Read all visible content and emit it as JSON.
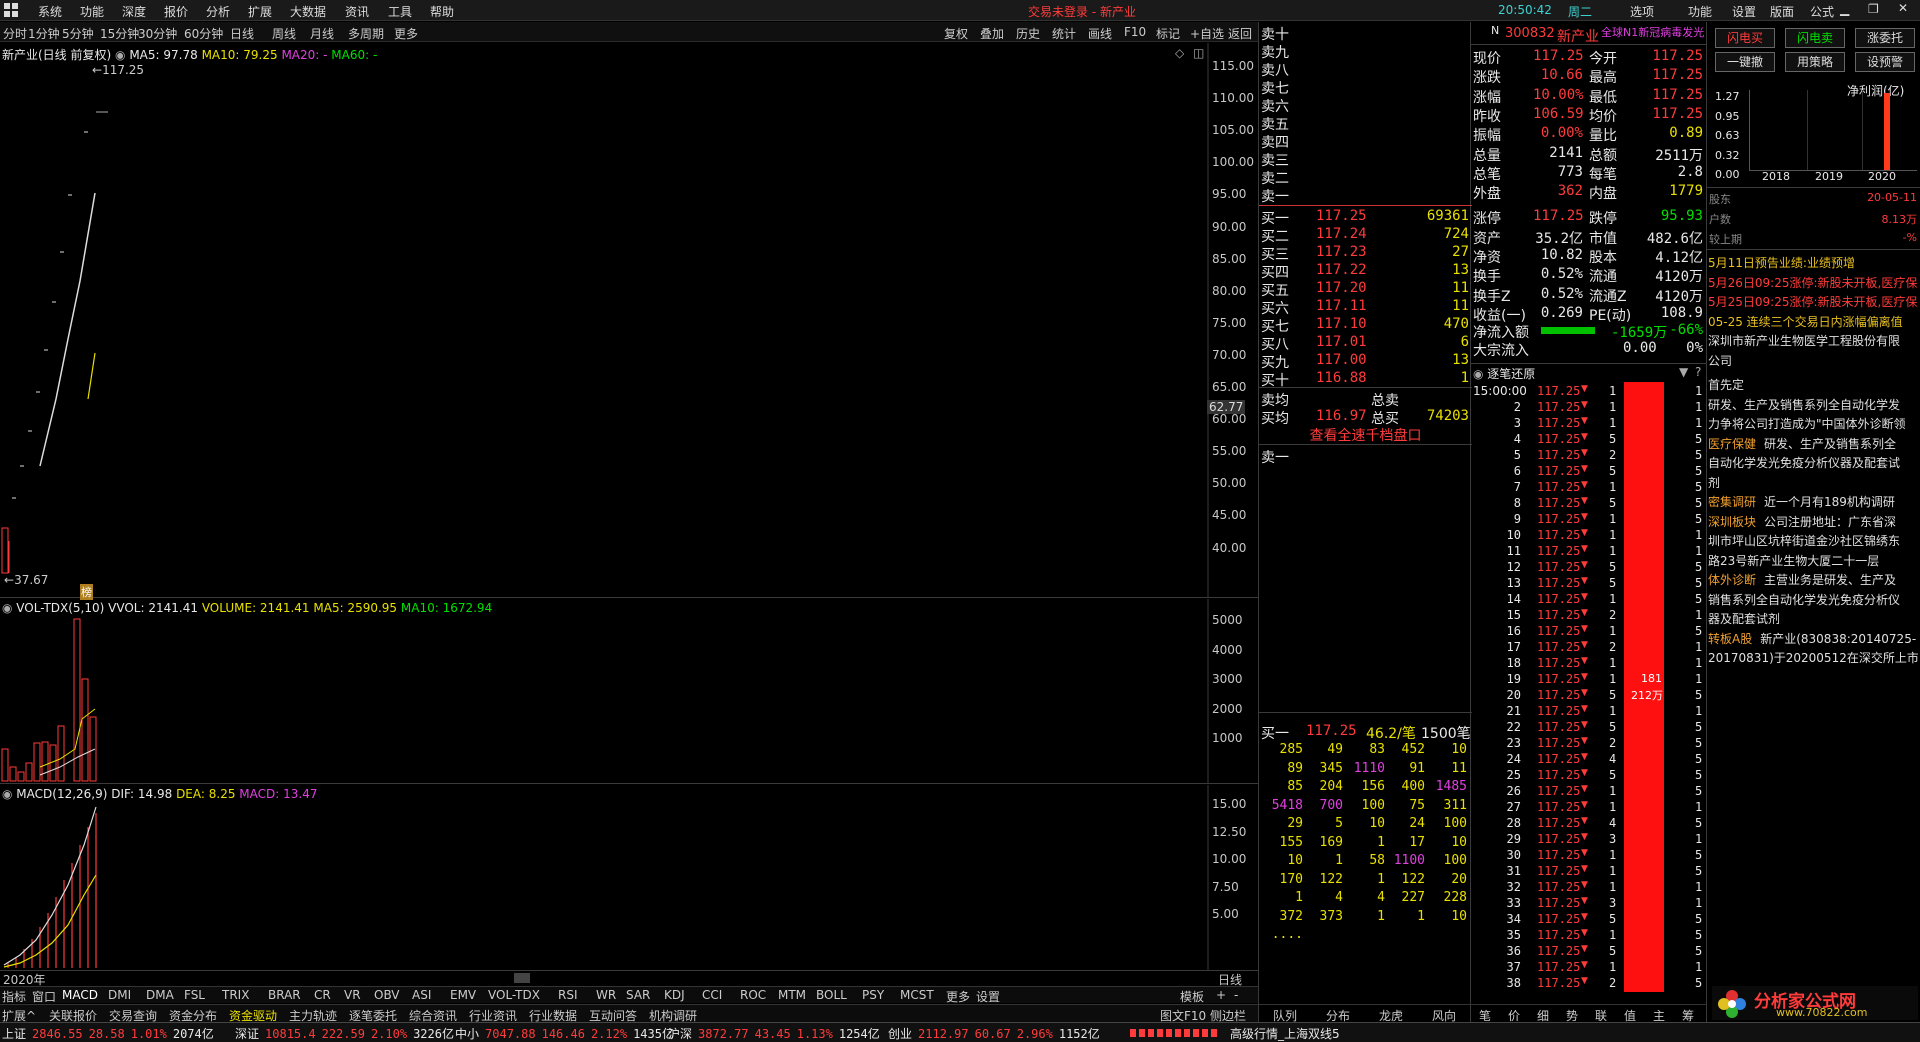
{
  "menu": {
    "items": [
      "系统",
      "功能",
      "深度",
      "报价",
      "分析",
      "扩展",
      "大数据",
      "资讯",
      "工具",
      "帮助"
    ],
    "center_title": "交易未登录 - 新产业",
    "clock": "20:50:42",
    "weekday": "周二",
    "right_items": [
      "选项",
      "功能",
      "设置",
      "版面",
      "公式"
    ]
  },
  "timeframes": [
    "分时",
    "1分钟",
    "5分钟",
    "15分钟",
    "30分钟",
    "60分钟",
    "日线",
    "周线",
    "月线",
    "多周期",
    "更多"
  ],
  "toolbar": [
    "复权",
    "叠加",
    "历史",
    "统计",
    "画线",
    "F10",
    "标记",
    "+自选",
    "返回"
  ],
  "kline": {
    "title": "新产业(日线 前复权)",
    "ma5": "MA5: 97.78",
    "ma10": "MA10: 79.25",
    "ma20": "MA20: -",
    "ma60": "MA60: -",
    "high_label": "117.25",
    "low_label": "37.67",
    "bang": "榜",
    "cursor_price": "62.77",
    "yaxis": [
      "115.00",
      "110.00",
      "105.00",
      "100.00",
      "95.00",
      "90.00",
      "85.00",
      "80.00",
      "75.00",
      "70.00",
      "65.00",
      "60.00",
      "55.00",
      "50.00",
      "45.00",
      "40.00"
    ]
  },
  "vol": {
    "title": "VOL-TDX(5,10)",
    "vvol": "VVOL: 2141.41",
    "volume": "VOLUME: 2141.41",
    "ma5": "MA5: 2590.95",
    "ma10": "MA10: 1672.94",
    "yaxis": [
      "5000",
      "4000",
      "3000",
      "2000",
      "1000"
    ]
  },
  "macd": {
    "title": "MACD(12,26,9)",
    "dif": "DIF: 14.98",
    "dea": "DEA: 8.25",
    "macd": "MACD: 13.47",
    "yaxis": [
      "15.00",
      "12.50",
      "10.00",
      "7.50",
      "5.00"
    ]
  },
  "year_label": "2020年",
  "period_label": "日线",
  "indicator_tabs": [
    "指标",
    "窗口",
    "MACD",
    "DMI",
    "DMA",
    "FSL",
    "TRIX",
    "BRAR",
    "CR",
    "VR",
    "OBV",
    "ASI",
    "EMV",
    "VOL-TDX",
    "RSI",
    "WR",
    "SAR",
    "KDJ",
    "CCI",
    "ROC",
    "MTM",
    "BOLL",
    "PSY",
    "MCST",
    "更多",
    "设置"
  ],
  "bottom_tabs": [
    "扩展^",
    "关联报价",
    "交易查询",
    "资金分布",
    "资金驱动",
    "主力轨迹",
    "逐笔委托",
    "综合资讯",
    "行业资讯",
    "行业数据",
    "互动问答",
    "机构调研"
  ],
  "bottom_right_tabs": [
    "模板",
    "+",
    "-",
    "图文F10",
    "侧边栏"
  ],
  "orderbook": {
    "sell_labels": [
      "卖十",
      "卖九",
      "卖八",
      "卖七",
      "卖六",
      "卖五",
      "卖四",
      "卖三",
      "卖二",
      "卖一"
    ],
    "buys": [
      [
        "买一",
        "117.25",
        "69361"
      ],
      [
        "买二",
        "117.24",
        "724"
      ],
      [
        "买三",
        "117.23",
        "27"
      ],
      [
        "买四",
        "117.22",
        "13"
      ],
      [
        "买五",
        "117.20",
        "11"
      ],
      [
        "买六",
        "117.11",
        "11"
      ],
      [
        "买七",
        "117.10",
        "470"
      ],
      [
        "买八",
        "117.01",
        "6"
      ],
      [
        "买九",
        "117.00",
        "13"
      ],
      [
        "买十",
        "116.88",
        "1"
      ]
    ],
    "avg_sell_label": "卖均",
    "total_sell_label": "总卖",
    "avg_buy_label": "买均",
    "avg_buy": "116.97",
    "total_buy_label": "总买",
    "total_buy": "74203",
    "view_all": "查看全速千档盘口",
    "sell1": "卖一",
    "queue_head": [
      "买一",
      "117.25",
      "46.2/笔",
      "1500笔"
    ],
    "queue": [
      [
        "285",
        "49",
        "83",
        "452",
        "10"
      ],
      [
        "89",
        "345",
        "1110",
        "91",
        "11"
      ],
      [
        "85",
        "204",
        "156",
        "400",
        "1485"
      ],
      [
        "5418",
        "700",
        "100",
        "75",
        "311"
      ],
      [
        "29",
        "5",
        "10",
        "24",
        "100"
      ],
      [
        "155",
        "169",
        "1",
        "17",
        "10"
      ],
      [
        "10",
        "1",
        "58",
        "1100",
        "100"
      ],
      [
        "170",
        "122",
        "1",
        "122",
        "20"
      ],
      [
        "1",
        "4",
        "4",
        "227",
        "228"
      ],
      [
        "372",
        "373",
        "1",
        "1",
        "10"
      ],
      [
        "....",
        "",
        "",
        "",
        ""
      ]
    ],
    "tabs": [
      "队列",
      "分布",
      "龙虎",
      "风向"
    ]
  },
  "quote": {
    "code": "300832",
    "name": "新产业",
    "tag": "N",
    "promo": "全球N1新冠病毒发光",
    "rows": [
      [
        "现价",
        "117.25",
        "今开",
        "117.25"
      ],
      [
        "涨跌",
        "10.66",
        "最高",
        "117.25"
      ],
      [
        "涨幅",
        "10.00%",
        "最低",
        "117.25"
      ],
      [
        "昨收",
        "106.59",
        "均价",
        "117.25"
      ],
      [
        "振幅",
        "0.00%",
        "量比",
        "0.89"
      ],
      [
        "总量",
        "2141",
        "总额",
        "2511万"
      ],
      [
        "总笔",
        "773",
        "每笔",
        "2.8"
      ],
      [
        "外盘",
        "362",
        "内盘",
        "1779"
      ],
      [
        "涨停",
        "117.25",
        "跌停",
        "95.93"
      ],
      [
        "资产",
        "35.2亿",
        "市值",
        "482.6亿"
      ],
      [
        "净资",
        "10.82",
        "股本",
        "4.12亿"
      ],
      [
        "换手",
        "0.52%",
        "流通",
        "4120万"
      ],
      [
        "换手Z",
        "0.52%",
        "流通Z",
        "4120万"
      ],
      [
        "收益(一)",
        "0.269",
        "PE(动)",
        "108.9"
      ]
    ],
    "inflow_label": "净流入额",
    "inflow_val": "-1659万",
    "inflow_pct": "-66%",
    "block_label": "大宗流入",
    "block_val": "0.00",
    "block_pct": "0%"
  },
  "ticks": {
    "title": "逐笔还原",
    "first_time": "15:00:00",
    "price": "117.25",
    "vols": [
      "1",
      "1",
      "1",
      "5",
      "2",
      "5",
      "1",
      "5",
      "1",
      "1",
      "1",
      "5",
      "5",
      "1",
      "2",
      "1",
      "2",
      "1",
      "1",
      "5",
      "1",
      "5",
      "2",
      "4",
      "5",
      "1",
      "1",
      "4",
      "3",
      "1",
      "1",
      "1",
      "3",
      "5",
      "1",
      "5",
      "1",
      "2"
    ],
    "rcol": [
      "1",
      "1",
      "1",
      "5",
      "5",
      "5",
      "5",
      "5",
      "5",
      "1",
      "1",
      "5",
      "5",
      "5",
      "1",
      "5",
      "1",
      "1",
      "1",
      "5",
      "1",
      "5",
      "5",
      "5",
      "5",
      "5",
      "1",
      "5",
      "1",
      "5",
      "5",
      "1",
      "1",
      "5",
      "5",
      "5",
      "1",
      "5"
    ],
    "bar_top": "181",
    "bar_mid": "212万",
    "tabs": [
      "笔",
      "价",
      "细",
      "势",
      "联",
      "值",
      "主",
      "筹"
    ]
  },
  "side": {
    "buttons": [
      "闪电买",
      "闪电卖",
      "涨委托",
      "一键撤",
      "用策略",
      "设预警"
    ],
    "chart_title": "净利润(亿)",
    "chart_yaxis": [
      "1.27",
      "0.95",
      "0.63",
      "0.32",
      "0.00"
    ],
    "chart_years": [
      "2018",
      "2019",
      "2020"
    ],
    "chart_data": {
      "type": "bar",
      "categories": [
        "2018",
        "2019",
        "2020"
      ],
      "values": [
        0,
        0,
        1.27
      ],
      "title": "净利润(亿)",
      "ylim": [
        0,
        1.27
      ]
    },
    "holders_label": "股东",
    "holders_date": "20-05-11",
    "households_label": "户数",
    "households_val": "8.13万",
    "prev_label": "较上期",
    "prev_val": "-%",
    "news": [
      "5月11日预告业绩:业绩预增",
      "5月26日09:25涨停:新股未开板,医疗保",
      "5月25日09:25涨停:新股未开板,医疗保",
      "05-25  连续三个交易日内涨幅偏离值",
      "深圳市新产业生物医学工程股份有限",
      "公司"
    ]
  },
  "f10": [
    [
      "首先定",
      ""
    ],
    [
      "研发、生产及销售系列全自动化学发",
      ""
    ],
    [
      "力争将公司打造成为\"中国体外诊断领",
      ""
    ],
    [
      "医疗保健",
      "研发、生产及销售系列全"
    ],
    [
      "自动化学发光免疫分析仪器及配套试",
      ""
    ],
    [
      "剂",
      ""
    ],
    [
      "密集调研",
      "近一个月有189机构调研"
    ],
    [
      "深圳板块",
      "公司注册地址：广东省深"
    ],
    [
      "圳市坪山区坑梓街道金沙社区锦绣东",
      ""
    ],
    [
      "路23号新产业生物大厦二十一层",
      ""
    ],
    [
      "体外诊断",
      "主营业务是研发、生产及"
    ],
    [
      "销售系列全自动化学发光免疫分析仪",
      ""
    ],
    [
      "器及配套试剂",
      ""
    ],
    [
      "转板A股",
      "新产业(830838:20140725-"
    ],
    [
      "20170831)于20200512在深交所上市",
      ""
    ]
  ],
  "status": {
    "items": [
      [
        "上证",
        "2846.55",
        "28.58",
        "1.01%",
        "2074亿"
      ],
      [
        "深证",
        "10815.4",
        "222.59",
        "2.10%",
        "3226亿"
      ],
      [
        "中小",
        "7047.88",
        "146.46",
        "2.12%",
        "1435亿"
      ],
      [
        "沪深",
        "3872.77",
        "43.45",
        "1.13%",
        "1254亿"
      ],
      [
        "创业",
        "2112.97",
        "60.67",
        "2.96%",
        "1152亿"
      ]
    ],
    "ticker": "高级行情_上海双线5"
  },
  "logo": {
    "text": "分析家公式网",
    "url": "www.70822.com"
  }
}
